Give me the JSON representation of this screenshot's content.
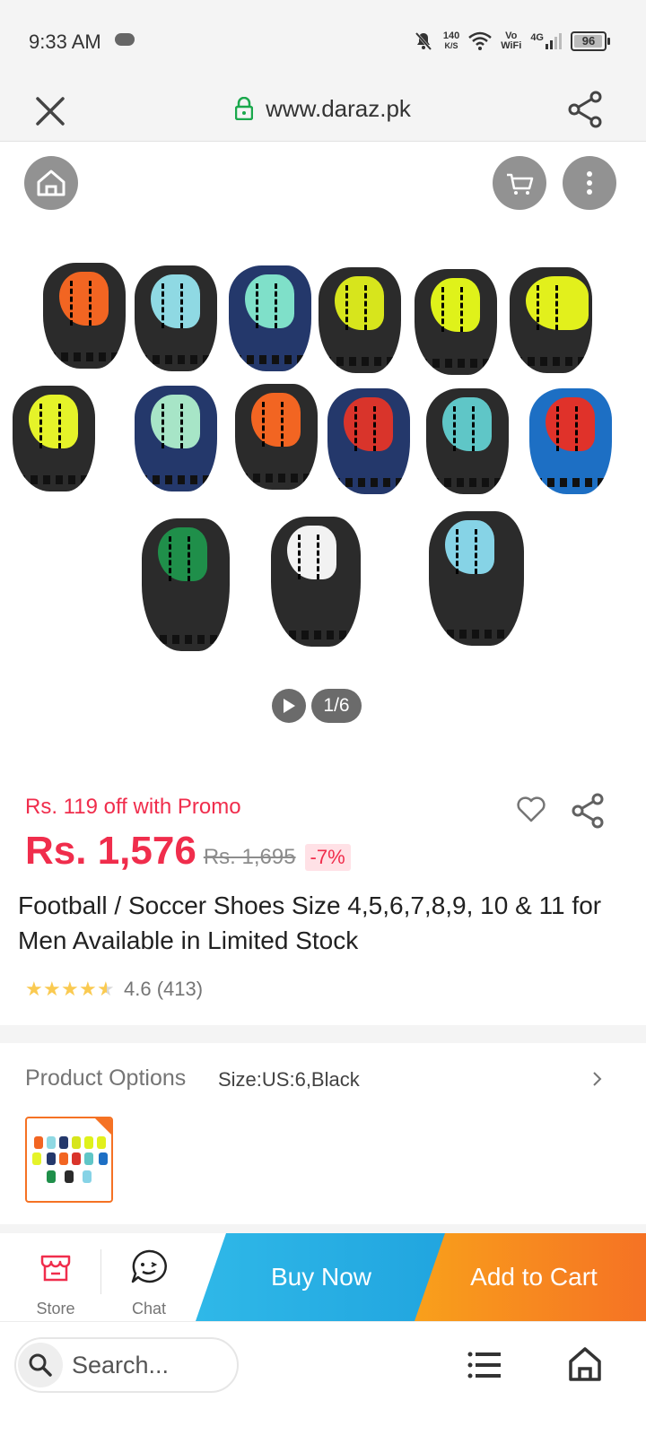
{
  "status_bar": {
    "time": "9:33 AM",
    "net_speed_value": "140",
    "net_speed_unit": "K/S",
    "vowifi_top": "Vo",
    "vowifi_bottom": "WiFi",
    "network": "4G",
    "battery": "96"
  },
  "browser": {
    "url": "www.daraz.pk"
  },
  "gallery": {
    "counter": "1/6"
  },
  "product": {
    "promo": "Rs. 119 off with Promo",
    "price": "Rs. 1,576",
    "original_price": "Rs. 1,695",
    "discount": "-7%",
    "title": "Football / Soccer Shoes Size 4,5,6,7,8,9, 10 & 11 for Men Available in Limited Stock",
    "rating": "4.6",
    "review_count": "(413)",
    "rating_value": 4.6
  },
  "options": {
    "label": "Product Options",
    "selected": "Size:US:6,Black"
  },
  "actions": {
    "store_label": "Store",
    "chat_label": "Chat",
    "buy_now_label": "Buy Now",
    "add_to_cart_label": "Add to Cart"
  },
  "bottom_nav": {
    "search_placeholder": "Search..."
  },
  "colors": {
    "price_red": "#f02d4c",
    "buy_now_blue": "#26adE4",
    "add_to_cart_orange": "#f57224",
    "star_yellow": "#faca51"
  }
}
